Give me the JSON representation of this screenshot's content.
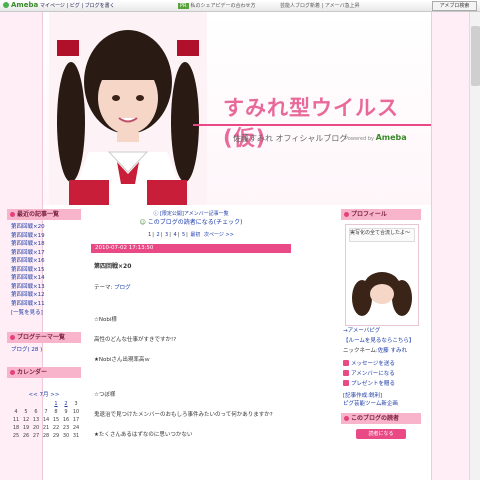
{
  "topbar": {
    "logo": "Ameba",
    "nav": "マイページ | ピグ | ブログを書く",
    "badge": "PR",
    "mid": "私のシェアピデーの合わせ方",
    "right": "芸能人ブログ新着 | アメーバ急上昇",
    "search": "アメブロ検索"
  },
  "header": {
    "title": "すみれ型ウイルス(仮)",
    "subtitle": "佐藤すみれ オフィシャルブログ",
    "powered": "Powered by",
    "brand": "Ameba"
  },
  "left": {
    "recent_heading": "最近の記事一覧",
    "recent_items": [
      "第四回戦×20",
      "第四回戦×19",
      "第四回戦×18",
      "第四回戦×17",
      "第四回戦×16",
      "第四回戦×15",
      "第四回戦×14",
      "第四回戦×13",
      "第四回戦×12",
      "第四回戦×11"
    ],
    "recent_more": "[一覧を見る]",
    "theme_heading": "ブログテーマ一覧",
    "theme_item": "ブログ( 28 )",
    "calendar_heading": "カレンダー",
    "calendar_month": "<< 7月 >>",
    "calendar_rows": [
      [
        "",
        "",
        "",
        "",
        "1",
        "2",
        "3"
      ],
      [
        "4",
        "5",
        "6",
        "7",
        "8",
        "9",
        "10"
      ],
      [
        "11",
        "12",
        "13",
        "14",
        "15",
        "16",
        "17"
      ],
      [
        "18",
        "19",
        "20",
        "21",
        "22",
        "23",
        "24"
      ],
      [
        "25",
        "26",
        "27",
        "28",
        "29",
        "30",
        "31"
      ]
    ]
  },
  "center": {
    "notice": "[限定公開]アメンバー記事一覧",
    "reader": "このブログの読者になる(チェック)",
    "pager": [
      "1",
      "2",
      "3",
      "4",
      "5",
      "最初",
      "次ページ >>"
    ],
    "entry_date": "2010-07-02 17:13:50",
    "entry_title": "第四回戦×20",
    "theme_label": "テーマ:",
    "theme_value": "ブログ",
    "body": [
      "☆Nobi様",
      "高性のどんな仕事がすきですか!?",
      "★Nobiさん出現率高ｗ",
      "☆つぼ様",
      "鬼退治で見つけたメンバーのおもしろ事件みたいのって何かありますか?",
      "★たくさんあるはずなのに思いつかない"
    ]
  },
  "right": {
    "profile_heading": "プロフィール",
    "profile_caption": "実写化の全て合流したよ〜",
    "avatar_link": "→アメーバピグ",
    "room_link": "【ルームを見るならこちら】",
    "nickname_label": "ニックネーム:",
    "nickname": "佐藤 すみれ",
    "msg_link": "メッセージを送る",
    "amember_link": "アメンバーになる",
    "present_link": "プレゼントを贈る",
    "prod": "[記事作成:鋭利]",
    "pig_room": "ピグ芸能ツーム新企画",
    "readers_heading": "このブログの読者",
    "reader_button": "読者になる"
  },
  "colors": {
    "accent": "#e94a86",
    "side_head": "#f8b4ca",
    "link": "#1a3aa8"
  }
}
